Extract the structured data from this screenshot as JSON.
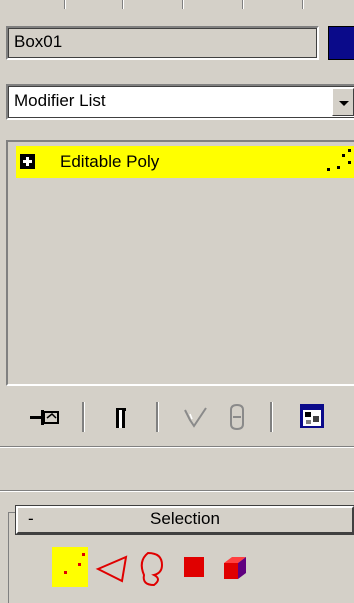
{
  "object": {
    "name": "Box01",
    "color": "#0a0a8a"
  },
  "modifier_list": {
    "label": "Modifier List"
  },
  "stack": {
    "items": [
      {
        "label": "Editable Poly",
        "selected": true,
        "highlight_color": "#ffff00"
      }
    ]
  },
  "toolbar": {
    "buttons": [
      "pin-stack-icon",
      "show-end-result-icon",
      "make-unique-icon",
      "remove-modifier-icon",
      "configure-modifier-sets-icon"
    ]
  },
  "rollout": {
    "toggle": "-",
    "title": "Selection",
    "subobject_levels": [
      "vertex-icon",
      "edge-icon",
      "border-icon",
      "polygon-icon",
      "element-icon"
    ],
    "active_level": "vertex-icon"
  }
}
